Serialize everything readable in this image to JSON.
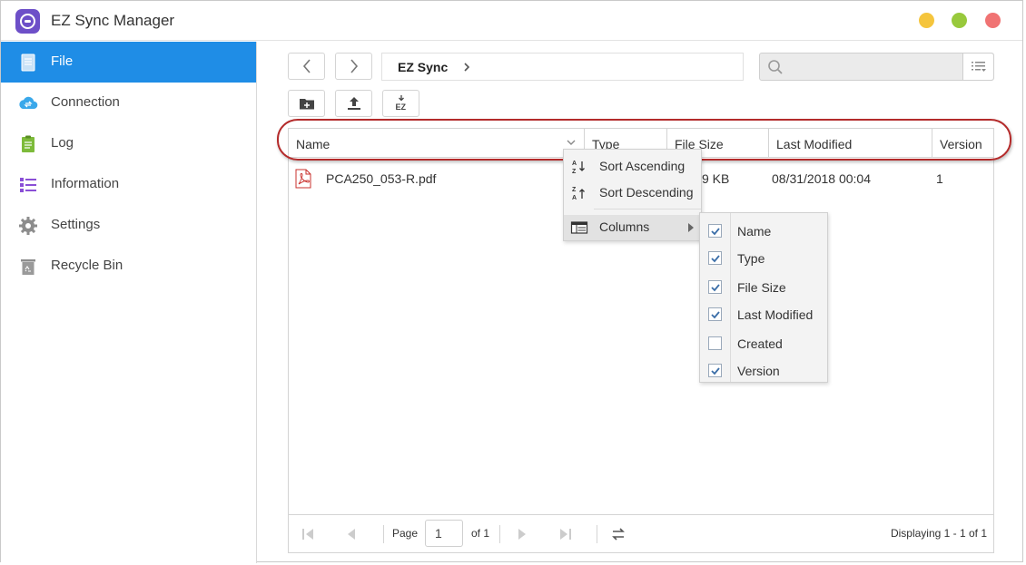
{
  "app": {
    "title": "EZ Sync Manager"
  },
  "sidebar": {
    "items": [
      {
        "label": "File",
        "icon": "file-icon",
        "active": true
      },
      {
        "label": "Connection",
        "icon": "cloud-connection-icon",
        "active": false
      },
      {
        "label": "Log",
        "icon": "log-icon",
        "active": false
      },
      {
        "label": "Information",
        "icon": "list-info-icon",
        "active": false
      },
      {
        "label": "Settings",
        "icon": "gear-icon",
        "active": false
      },
      {
        "label": "Recycle Bin",
        "icon": "recycle-bin-icon",
        "active": false
      }
    ]
  },
  "toolbar": {
    "path": "EZ Sync",
    "search_placeholder": "",
    "buttons": [
      "back-icon",
      "forward-icon",
      "new-folder-icon",
      "upload-icon",
      "ez-download-icon"
    ]
  },
  "grid": {
    "columns": [
      "Name",
      "Type",
      "File Size",
      "Last Modified",
      "Version"
    ],
    "rows": [
      {
        "name": "PCA250_053-R.pdf",
        "type": "",
        "size_visible": "9 KB",
        "modified": "08/31/2018 00:04",
        "version": "1"
      }
    ]
  },
  "context_menu": {
    "items": [
      "Sort Ascending",
      "Sort Descending",
      "Columns"
    ]
  },
  "columns_submenu": {
    "items": [
      {
        "label": "Name",
        "checked": true
      },
      {
        "label": "Type",
        "checked": true
      },
      {
        "label": "File Size",
        "checked": true
      },
      {
        "label": "Last Modified",
        "checked": true
      },
      {
        "label": "Created",
        "checked": false
      },
      {
        "label": "Version",
        "checked": true
      }
    ]
  },
  "pager": {
    "page_label": "Page",
    "page_value": "1",
    "of_label": "of 1",
    "display_text": "Displaying 1 - 1 of 1"
  },
  "colors": {
    "accent": "#1f8de6",
    "highlight_ring": "#b42b2b",
    "win_min": "#f5c53d",
    "win_max": "#98c93c",
    "win_close": "#f07373"
  }
}
